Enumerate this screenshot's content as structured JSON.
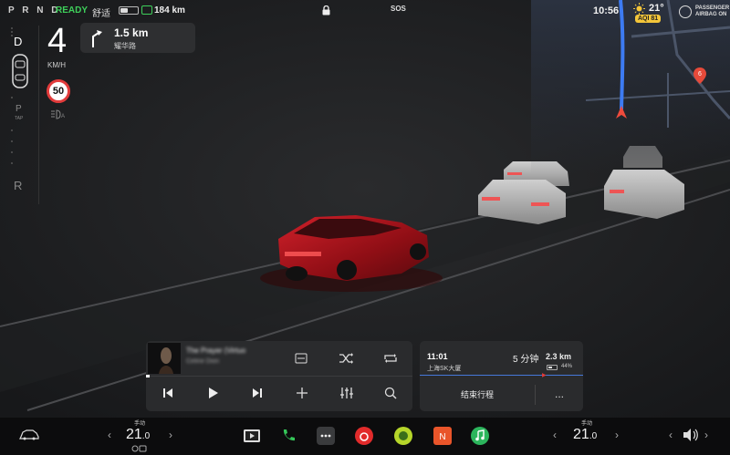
{
  "status": {
    "gears": "P R N D",
    "ready": "READY",
    "drive_mode": "舒适",
    "range": "184 km",
    "sos": "SOS",
    "time": "10:56",
    "temperature": "21°",
    "aqi": "AQI 81",
    "airbag_line1": "PASSENGER",
    "airbag_line2": "AIRBAG ON"
  },
  "gear_column": {
    "d": "D",
    "p": "P",
    "tap": "TAP",
    "r": "R"
  },
  "speed": {
    "value": "4",
    "unit": "KM/H",
    "limit": "50"
  },
  "navigation": {
    "distance": "1.5 km",
    "road": "耀华路"
  },
  "map": {
    "pin_label": "6",
    "route_color": "#3d7bf2"
  },
  "media": {
    "track": "The Prayer (Virtuo",
    "artist": "Celine Dion"
  },
  "trip": {
    "arrival": "11:01",
    "destination": "上海SK大厦",
    "eta": "5 分钟",
    "distance": "2.3 km",
    "battery": "44%",
    "battery_fraction": 0.44,
    "end_label": "结束行程",
    "more_label": "..."
  },
  "climate": {
    "left": {
      "mode": "手动",
      "temp": "21",
      "decimal": ".0"
    },
    "right": {
      "mode": "手动",
      "temp": "21",
      "decimal": ".0"
    }
  },
  "colors": {
    "accent_green": "#3ecf5a",
    "alert_red": "#e23b3b",
    "car_red": "#b3121a"
  }
}
